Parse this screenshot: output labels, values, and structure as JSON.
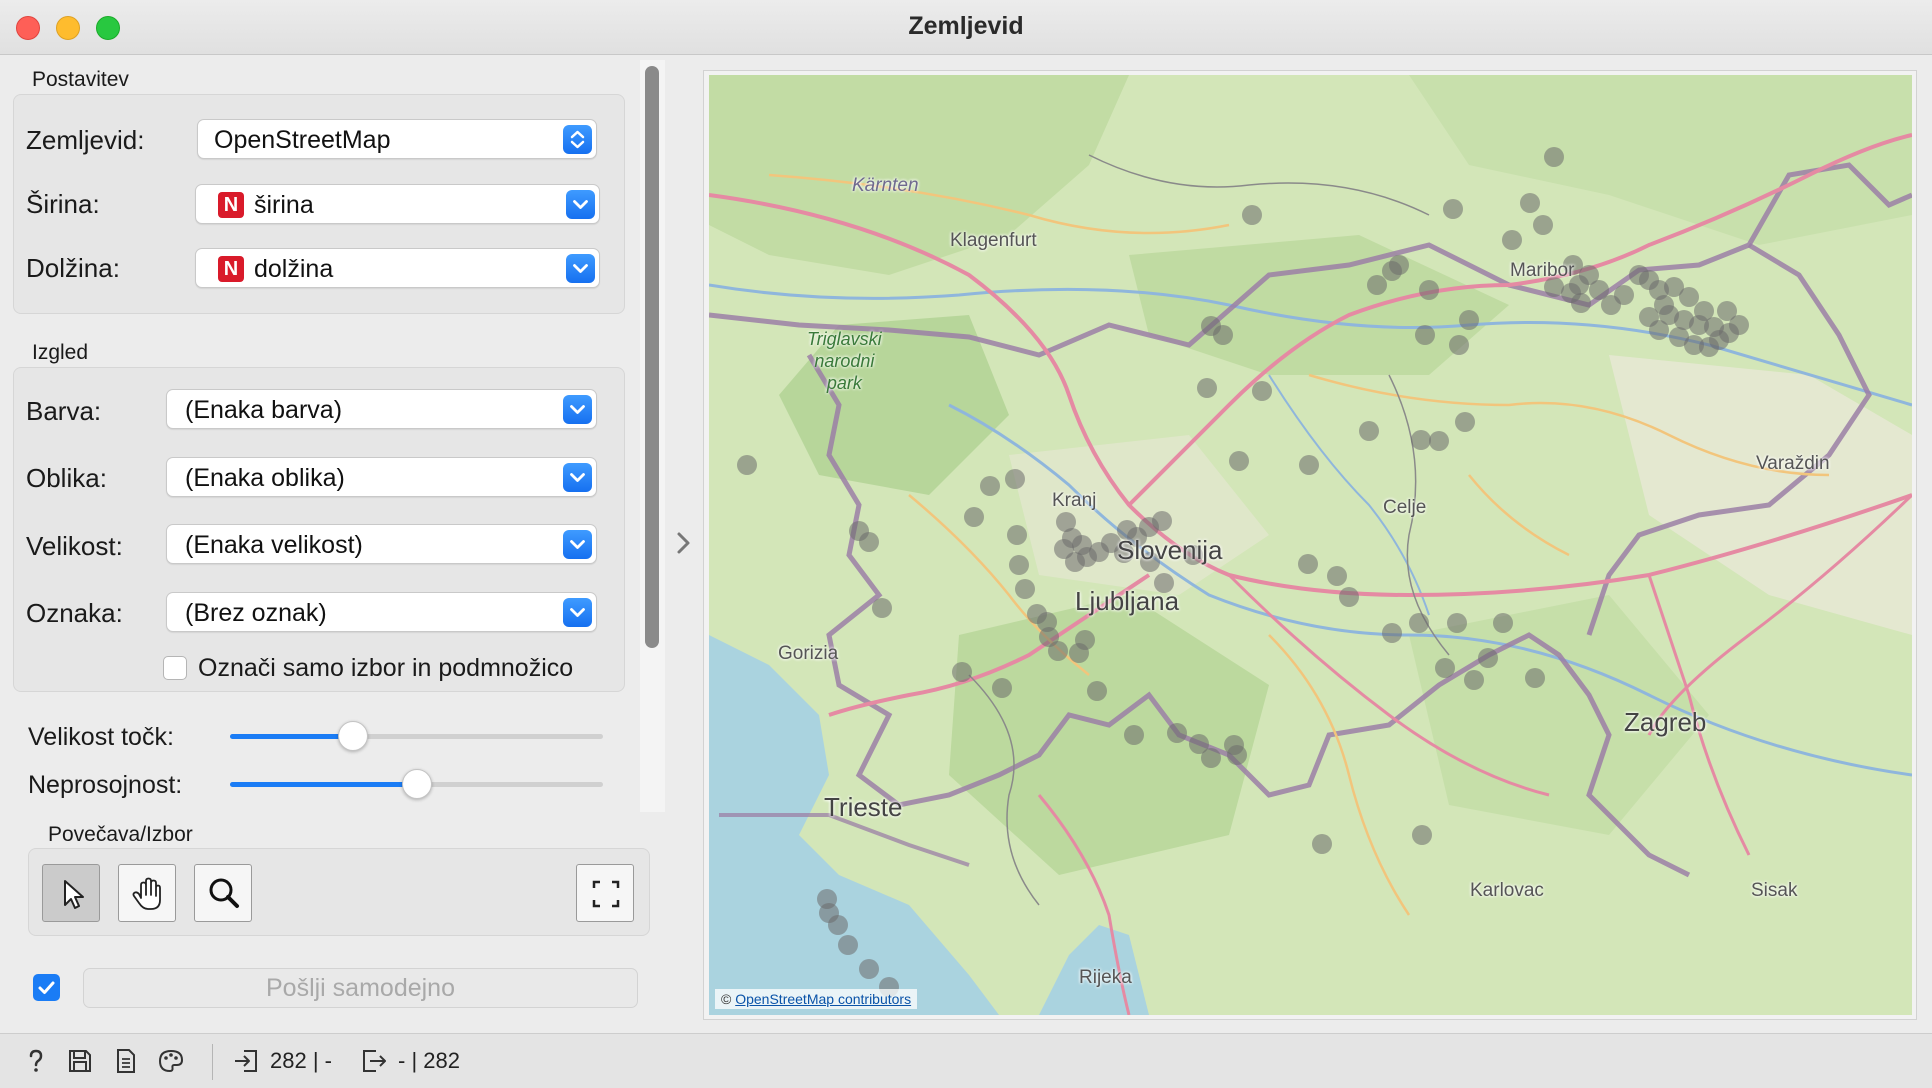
{
  "window": {
    "title": "Zemljevid"
  },
  "sections": {
    "setup": "Postavitev",
    "appearance": "Izgled",
    "zoom": "Povečava/Izbor"
  },
  "setup": {
    "map_label": "Zemljevid:",
    "map_value": "OpenStreetMap",
    "lat_label": "Širina:",
    "lat_value": "širina",
    "lon_label": "Dolžina:",
    "lon_value": "dolžina",
    "numeric_badge": "N"
  },
  "appearance": {
    "color_label": "Barva:",
    "color_value": "(Enaka barva)",
    "shape_label": "Oblika:",
    "shape_value": "(Enaka oblika)",
    "size_label": "Velikost:",
    "size_value": "(Enaka velikost)",
    "label_label": "Oznaka:",
    "label_value": "(Brez oznak)",
    "label_only_selected": "Označi samo izbor in podmnožico",
    "label_only_selected_checked": false,
    "point_size_label": "Velikost točk:",
    "point_size_fraction": 0.33,
    "opacity_label": "Neprosojnost:",
    "opacity_fraction": 0.5
  },
  "zoom_tools": {
    "active_tool": "select",
    "tools": [
      "select",
      "pan",
      "zoom",
      "reset-zoom"
    ]
  },
  "send": {
    "auto_checked": true,
    "label": "Pošlji samodejno"
  },
  "map": {
    "places": {
      "karnten": "Kärnten",
      "klagenfurt": "Klagenfurt",
      "maribor": "Maribor",
      "triglav": "Triglavski\nnarodni\npark",
      "varazdin": "Varaždin",
      "kranj": "Kranj",
      "celje": "Celje",
      "slovenija": "Slovenija",
      "ljubljana": "Ljubljana",
      "gorizia": "Gorizia",
      "zagreb": "Zagreb",
      "trieste": "Trieste",
      "karlovac": "Karlovac",
      "sisak": "Sisak",
      "rijeka": "Rijeka"
    },
    "attribution_prefix": "©",
    "attribution_link": "OpenStreetMap contributors",
    "point_color": "#6b6b6b"
  },
  "status": {
    "input_summary": "282 | -",
    "output_summary": "- | 282"
  }
}
